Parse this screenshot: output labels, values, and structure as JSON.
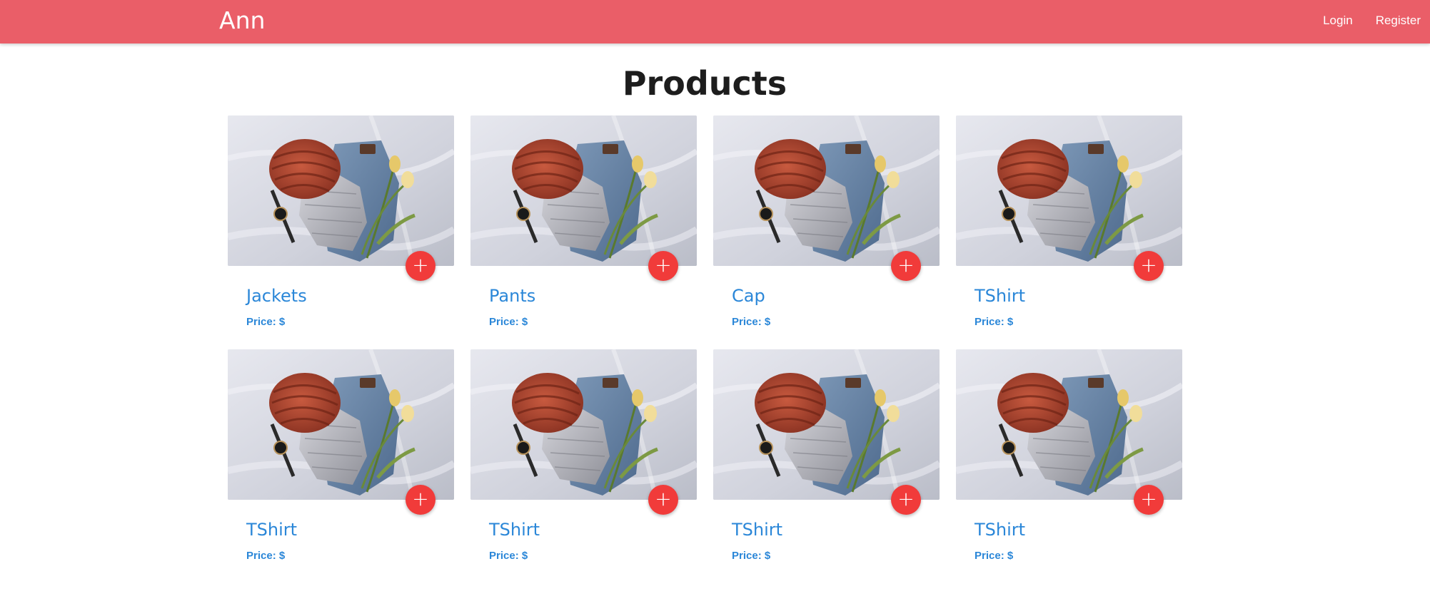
{
  "navbar": {
    "brand": "Ann",
    "links": [
      "Login",
      "Register"
    ],
    "color": "#ea5e68"
  },
  "page_title": "Products",
  "add_button": {
    "icon": "plus-icon",
    "glyph": "+",
    "color": "#f13b3a"
  },
  "price_label": "Price: $",
  "accent_color": "#2b87d8",
  "products": [
    {
      "name": "Jackets",
      "price": ""
    },
    {
      "name": "Pants",
      "price": ""
    },
    {
      "name": "Cap",
      "price": ""
    },
    {
      "name": "TShirt",
      "price": ""
    },
    {
      "name": "TShirt",
      "price": ""
    },
    {
      "name": "TShirt",
      "price": ""
    },
    {
      "name": "TShirt",
      "price": ""
    },
    {
      "name": "TShirt",
      "price": ""
    }
  ]
}
